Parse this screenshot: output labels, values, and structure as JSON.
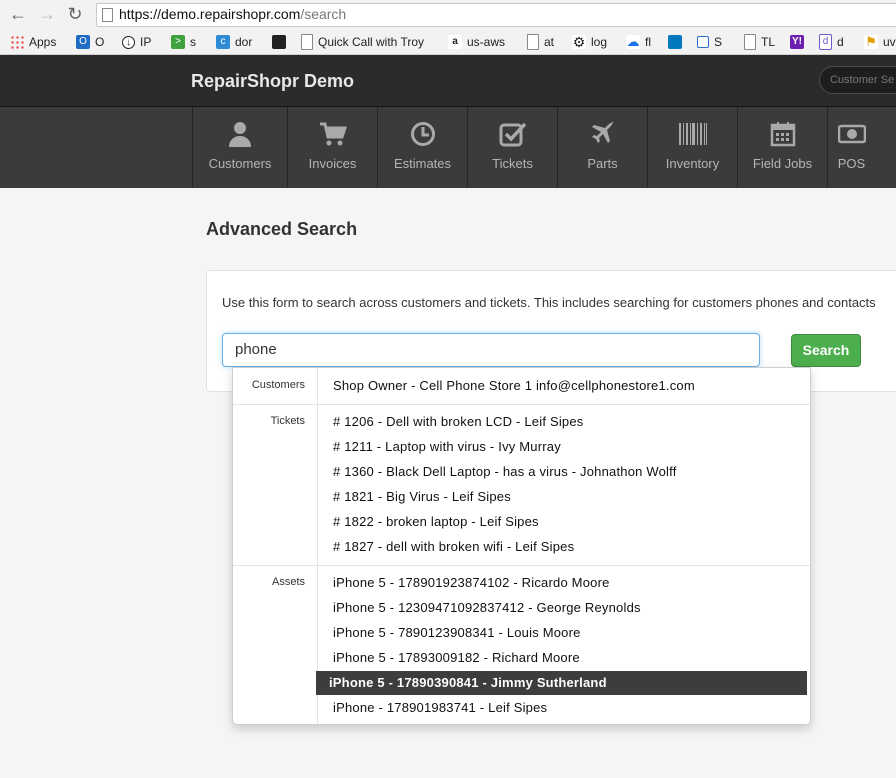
{
  "browser": {
    "url_host": "https://demo.repairshopr.com",
    "url_path": "/search",
    "bookmarks": [
      "Apps",
      "O",
      "IP",
      "s",
      "dor",
      "",
      "Quick Call with Troy",
      "us-aws",
      "at",
      "log",
      "fl",
      "",
      "S",
      "TL",
      "",
      "d",
      "uv"
    ]
  },
  "header": {
    "brand": "RepairShopr Demo",
    "customer_search_placeholder": "Customer Se"
  },
  "tabs": [
    {
      "label": "Customers",
      "icon": "user-icon"
    },
    {
      "label": "Invoices",
      "icon": "cart-icon"
    },
    {
      "label": "Estimates",
      "icon": "clock-icon"
    },
    {
      "label": "Tickets",
      "icon": "check-icon"
    },
    {
      "label": "Parts",
      "icon": "plane-icon"
    },
    {
      "label": "Inventory",
      "icon": "barcode-icon"
    },
    {
      "label": "Field Jobs",
      "icon": "calendar-icon"
    },
    {
      "label": "POS",
      "icon": "money-icon"
    }
  ],
  "main": {
    "title": "Advanced Search",
    "intro": "Use this form to search across customers and tickets. This includes searching for customers phones and contacts",
    "search_value": "phone",
    "search_button": "Search"
  },
  "dropdown": {
    "customers_label": "Customers",
    "customers": [
      "Shop Owner - Cell Phone Store 1 info@cellphonestore1.com"
    ],
    "tickets_label": "Tickets",
    "tickets": [
      "# 1206 - Dell with broken LCD - Leif Sipes",
      "# 1211 - Laptop with virus - Ivy Murray",
      "# 1360 - Black Dell Laptop - has a virus - Johnathon Wolff",
      "# 1821 - Big Virus - Leif Sipes",
      "# 1822 - broken laptop - Leif Sipes",
      "# 1827 - dell with broken wifi - Leif Sipes"
    ],
    "assets_label": "Assets",
    "assets": [
      "iPhone 5 - 178901923874102 - Ricardo Moore",
      "iPhone 5 - 12309471092837412 - George Reynolds",
      "iPhone 5 - 7890123908341 - Louis Moore",
      "iPhone 5 - 17893009182 - Richard Moore",
      "iPhone 5 - 17890390841 - Jimmy Sutherland",
      "iPhone - 178901983741 - Leif Sipes"
    ],
    "active_asset_index": 4
  }
}
